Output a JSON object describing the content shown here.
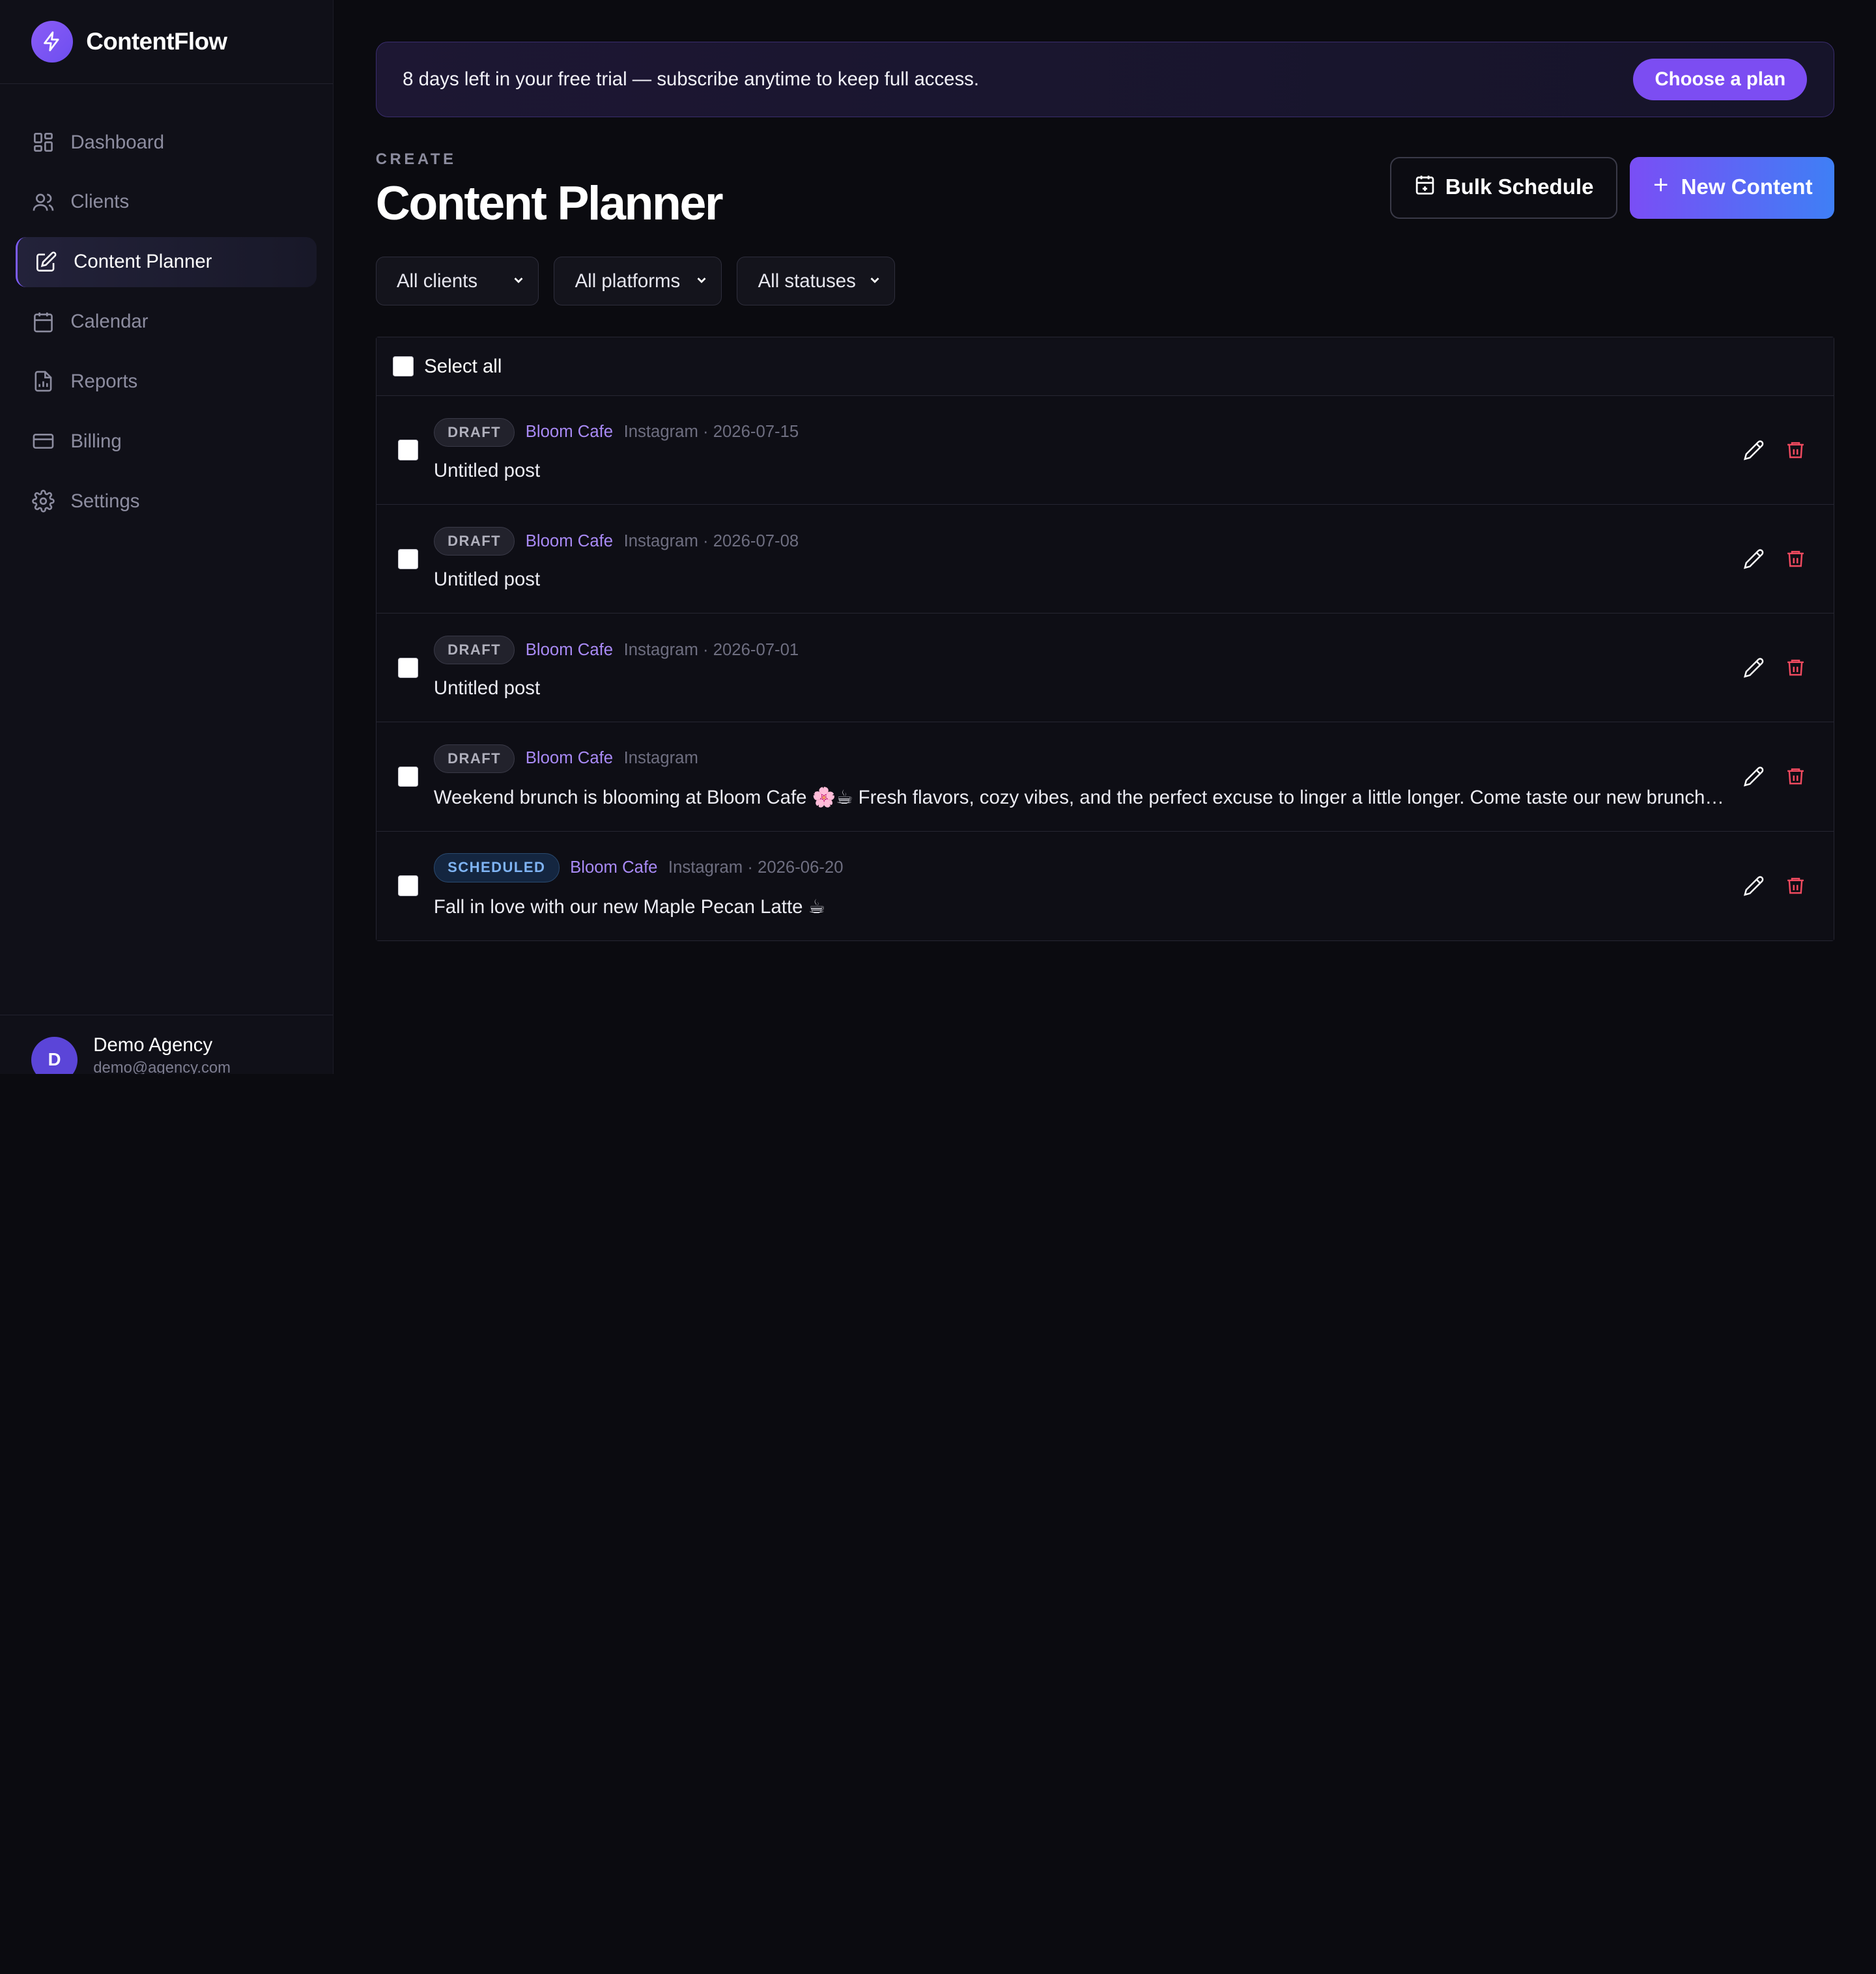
{
  "brand": {
    "name": "ContentFlow",
    "logo_icon": "bolt-icon",
    "accent": "#7c4df2"
  },
  "sidebar": {
    "items": [
      {
        "label": "Dashboard",
        "icon": "dashboard-icon",
        "active": false
      },
      {
        "label": "Clients",
        "icon": "users-icon",
        "active": false
      },
      {
        "label": "Content Planner",
        "icon": "edit-icon",
        "active": true
      },
      {
        "label": "Calendar",
        "icon": "calendar-icon",
        "active": false
      },
      {
        "label": "Reports",
        "icon": "report-icon",
        "active": false
      },
      {
        "label": "Billing",
        "icon": "credit-card-icon",
        "active": false
      },
      {
        "label": "Settings",
        "icon": "gear-icon",
        "active": false
      }
    ],
    "user": {
      "initial": "D",
      "name": "Demo Agency",
      "email": "demo@agency.com"
    }
  },
  "banner": {
    "text": "8 days left in your free trial — subscribe anytime to keep full access.",
    "button": "Choose a plan"
  },
  "header": {
    "eyebrow": "CREATE",
    "title": "Content Planner",
    "bulk_label": "Bulk Schedule",
    "new_label": "New Content"
  },
  "filters": {
    "clients": "All clients",
    "platforms": "All platforms",
    "statuses": "All statuses"
  },
  "list": {
    "select_all": "Select all",
    "rows": [
      {
        "status": "DRAFT",
        "client": "Bloom Cafe",
        "meta": "Instagram · 2026-07-15",
        "title": "Untitled post"
      },
      {
        "status": "DRAFT",
        "client": "Bloom Cafe",
        "meta": "Instagram · 2026-07-08",
        "title": "Untitled post"
      },
      {
        "status": "DRAFT",
        "client": "Bloom Cafe",
        "meta": "Instagram · 2026-07-01",
        "title": "Untitled post"
      },
      {
        "status": "DRAFT",
        "client": "Bloom Cafe",
        "meta": "Instagram",
        "title": "Weekend brunch is blooming at Bloom Cafe 🌸☕ Fresh flavors, cozy vibes, and the perfect excuse to linger a little longer. Come taste our new brunch…"
      },
      {
        "status": "SCHEDULED",
        "client": "Bloom Cafe",
        "meta": "Instagram · 2026-06-20",
        "title": "Fall in love with our new Maple Pecan Latte ☕"
      }
    ]
  }
}
